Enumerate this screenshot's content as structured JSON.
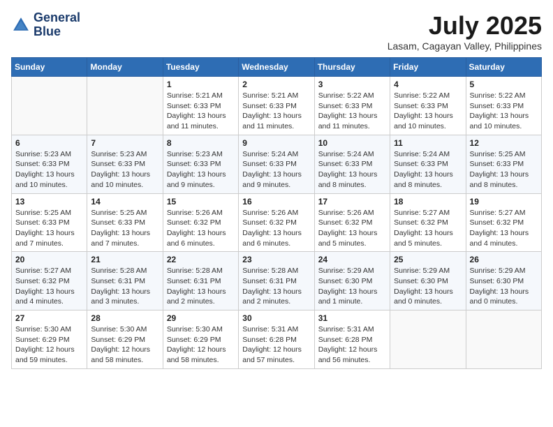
{
  "logo": {
    "line1": "General",
    "line2": "Blue"
  },
  "title": "July 2025",
  "location": "Lasam, Cagayan Valley, Philippines",
  "days_of_week": [
    "Sunday",
    "Monday",
    "Tuesday",
    "Wednesday",
    "Thursday",
    "Friday",
    "Saturday"
  ],
  "weeks": [
    [
      {
        "day": "",
        "detail": ""
      },
      {
        "day": "",
        "detail": ""
      },
      {
        "day": "1",
        "detail": "Sunrise: 5:21 AM\nSunset: 6:33 PM\nDaylight: 13 hours and 11 minutes."
      },
      {
        "day": "2",
        "detail": "Sunrise: 5:21 AM\nSunset: 6:33 PM\nDaylight: 13 hours and 11 minutes."
      },
      {
        "day": "3",
        "detail": "Sunrise: 5:22 AM\nSunset: 6:33 PM\nDaylight: 13 hours and 11 minutes."
      },
      {
        "day": "4",
        "detail": "Sunrise: 5:22 AM\nSunset: 6:33 PM\nDaylight: 13 hours and 10 minutes."
      },
      {
        "day": "5",
        "detail": "Sunrise: 5:22 AM\nSunset: 6:33 PM\nDaylight: 13 hours and 10 minutes."
      }
    ],
    [
      {
        "day": "6",
        "detail": "Sunrise: 5:23 AM\nSunset: 6:33 PM\nDaylight: 13 hours and 10 minutes."
      },
      {
        "day": "7",
        "detail": "Sunrise: 5:23 AM\nSunset: 6:33 PM\nDaylight: 13 hours and 10 minutes."
      },
      {
        "day": "8",
        "detail": "Sunrise: 5:23 AM\nSunset: 6:33 PM\nDaylight: 13 hours and 9 minutes."
      },
      {
        "day": "9",
        "detail": "Sunrise: 5:24 AM\nSunset: 6:33 PM\nDaylight: 13 hours and 9 minutes."
      },
      {
        "day": "10",
        "detail": "Sunrise: 5:24 AM\nSunset: 6:33 PM\nDaylight: 13 hours and 8 minutes."
      },
      {
        "day": "11",
        "detail": "Sunrise: 5:24 AM\nSunset: 6:33 PM\nDaylight: 13 hours and 8 minutes."
      },
      {
        "day": "12",
        "detail": "Sunrise: 5:25 AM\nSunset: 6:33 PM\nDaylight: 13 hours and 8 minutes."
      }
    ],
    [
      {
        "day": "13",
        "detail": "Sunrise: 5:25 AM\nSunset: 6:33 PM\nDaylight: 13 hours and 7 minutes."
      },
      {
        "day": "14",
        "detail": "Sunrise: 5:25 AM\nSunset: 6:33 PM\nDaylight: 13 hours and 7 minutes."
      },
      {
        "day": "15",
        "detail": "Sunrise: 5:26 AM\nSunset: 6:32 PM\nDaylight: 13 hours and 6 minutes."
      },
      {
        "day": "16",
        "detail": "Sunrise: 5:26 AM\nSunset: 6:32 PM\nDaylight: 13 hours and 6 minutes."
      },
      {
        "day": "17",
        "detail": "Sunrise: 5:26 AM\nSunset: 6:32 PM\nDaylight: 13 hours and 5 minutes."
      },
      {
        "day": "18",
        "detail": "Sunrise: 5:27 AM\nSunset: 6:32 PM\nDaylight: 13 hours and 5 minutes."
      },
      {
        "day": "19",
        "detail": "Sunrise: 5:27 AM\nSunset: 6:32 PM\nDaylight: 13 hours and 4 minutes."
      }
    ],
    [
      {
        "day": "20",
        "detail": "Sunrise: 5:27 AM\nSunset: 6:32 PM\nDaylight: 13 hours and 4 minutes."
      },
      {
        "day": "21",
        "detail": "Sunrise: 5:28 AM\nSunset: 6:31 PM\nDaylight: 13 hours and 3 minutes."
      },
      {
        "day": "22",
        "detail": "Sunrise: 5:28 AM\nSunset: 6:31 PM\nDaylight: 13 hours and 2 minutes."
      },
      {
        "day": "23",
        "detail": "Sunrise: 5:28 AM\nSunset: 6:31 PM\nDaylight: 13 hours and 2 minutes."
      },
      {
        "day": "24",
        "detail": "Sunrise: 5:29 AM\nSunset: 6:30 PM\nDaylight: 13 hours and 1 minute."
      },
      {
        "day": "25",
        "detail": "Sunrise: 5:29 AM\nSunset: 6:30 PM\nDaylight: 13 hours and 0 minutes."
      },
      {
        "day": "26",
        "detail": "Sunrise: 5:29 AM\nSunset: 6:30 PM\nDaylight: 13 hours and 0 minutes."
      }
    ],
    [
      {
        "day": "27",
        "detail": "Sunrise: 5:30 AM\nSunset: 6:29 PM\nDaylight: 12 hours and 59 minutes."
      },
      {
        "day": "28",
        "detail": "Sunrise: 5:30 AM\nSunset: 6:29 PM\nDaylight: 12 hours and 58 minutes."
      },
      {
        "day": "29",
        "detail": "Sunrise: 5:30 AM\nSunset: 6:29 PM\nDaylight: 12 hours and 58 minutes."
      },
      {
        "day": "30",
        "detail": "Sunrise: 5:31 AM\nSunset: 6:28 PM\nDaylight: 12 hours and 57 minutes."
      },
      {
        "day": "31",
        "detail": "Sunrise: 5:31 AM\nSunset: 6:28 PM\nDaylight: 12 hours and 56 minutes."
      },
      {
        "day": "",
        "detail": ""
      },
      {
        "day": "",
        "detail": ""
      }
    ]
  ]
}
